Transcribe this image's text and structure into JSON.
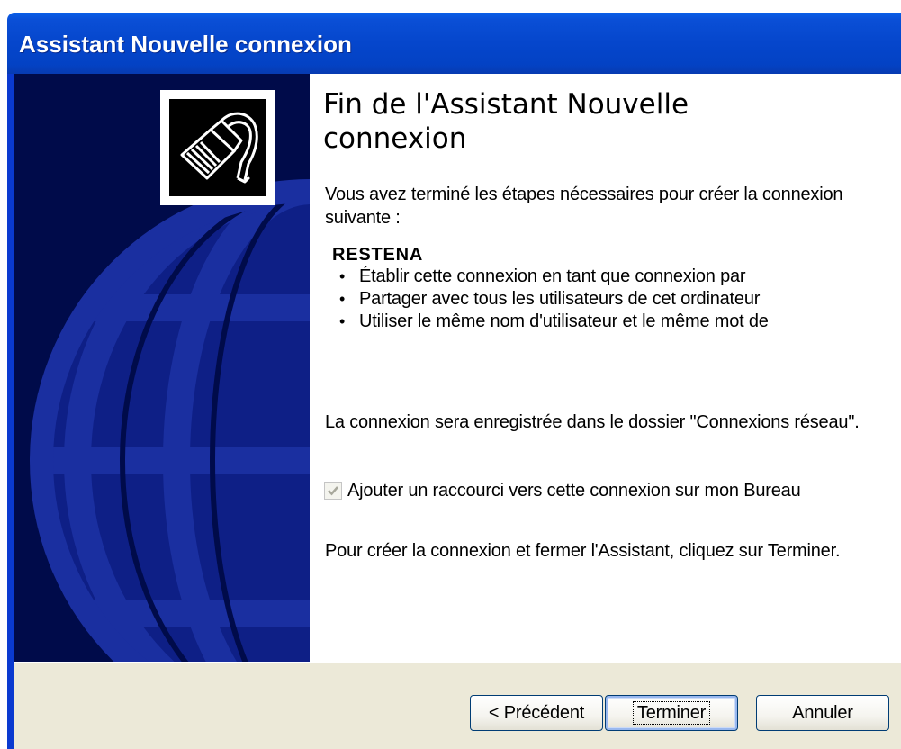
{
  "window": {
    "title": "Assistant Nouvelle connexion"
  },
  "icon": {
    "name": "network-cable-icon"
  },
  "main": {
    "heading": "Fin de l'Assistant Nouvelle connexion",
    "intro": "Vous avez terminé les étapes nécessaires pour créer la connexion suivante :",
    "connection_name": "RESTENA",
    "bullets": [
      "Établir cette connexion en tant que connexion par",
      "Partager avec tous les utilisateurs de cet ordinateur",
      "Utiliser le même nom d'utilisateur et le même mot de"
    ],
    "folder_note": "La connexion sera enregistrée dans le dossier \"Connexions réseau\".",
    "shortcut_checkbox": {
      "label": "Ajouter un raccourci vers cette connexion sur mon Bureau",
      "checked": true
    },
    "finish_note": "Pour créer la connexion et fermer l'Assistant, cliquez sur Terminer."
  },
  "footer": {
    "back_label": "< Précédent",
    "finish_label": "Terminer",
    "cancel_label": "Annuler"
  },
  "colors": {
    "titlebar": "#0546cc",
    "sidebar": "#000b4a",
    "globe": "#1a2fa0",
    "footer": "#ece9d8"
  }
}
